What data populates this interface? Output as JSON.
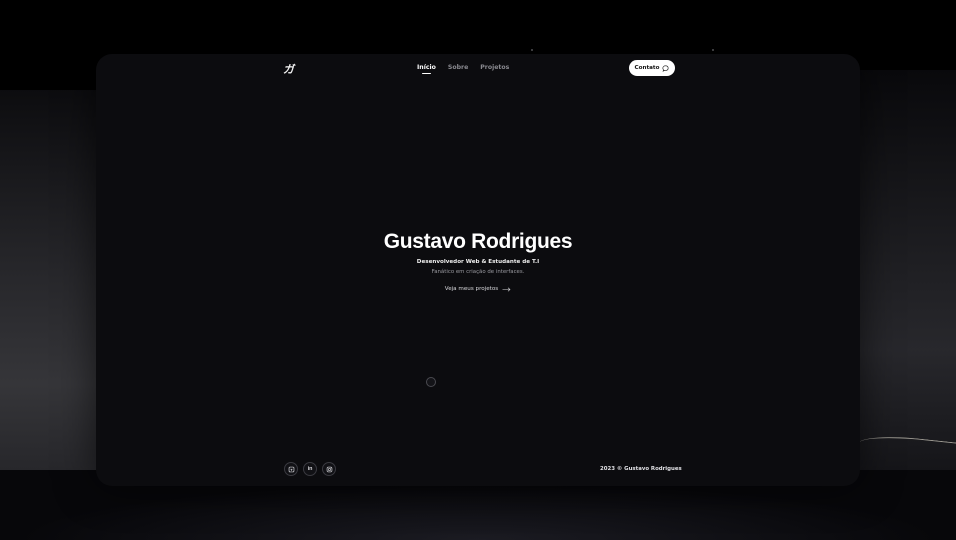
{
  "nav": {
    "logo": "ガ",
    "links": [
      {
        "label": "Início",
        "active": true
      },
      {
        "label": "Sobre",
        "active": false
      },
      {
        "label": "Projetos",
        "active": false
      }
    ],
    "contact_label": "Contato",
    "contact_icon": "chat-bubble-icon"
  },
  "hero": {
    "title": "Gustavo Rodrigues",
    "role": "Desenvolvedor Web & Estudante de T.I",
    "tagline": "Fanático em criação de interfaces.",
    "cta_label": "Veja meus projetos",
    "cta_icon": "arrow-right-icon"
  },
  "footer": {
    "socials": [
      {
        "name": "github-icon"
      },
      {
        "name": "linkedin-icon",
        "text": "in"
      },
      {
        "name": "instagram-icon"
      }
    ],
    "copyright": "2023 © Gustavo Rodrigues"
  },
  "colors": {
    "page_background": "#000000",
    "window_background": "#0c0c0f",
    "text_primary": "#ffffff",
    "text_muted": "#8a8a90",
    "button_background": "#ffffff"
  }
}
